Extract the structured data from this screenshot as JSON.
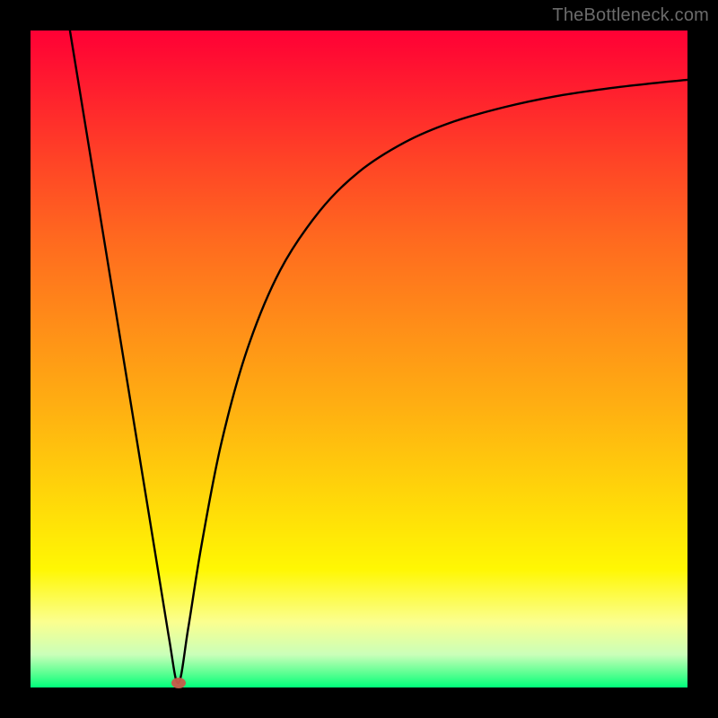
{
  "watermark": "TheBottleneck.com",
  "marker": {
    "x_pct": 22.5,
    "y_pct": 99.3
  },
  "curve_color": "#000000",
  "curve_stroke_width": 2.4,
  "chart_data": {
    "type": "line",
    "title": "",
    "xlabel": "",
    "ylabel": "",
    "xlim": [
      0,
      100
    ],
    "ylim": [
      0,
      100
    ],
    "grid": false,
    "annotations": [
      "TheBottleneck.com"
    ],
    "series": [
      {
        "name": "bottleneck-curve",
        "x": [
          6.0,
          10.0,
          14.0,
          18.0,
          21.0,
          22.5,
          24.0,
          26.0,
          29.0,
          33.0,
          38.0,
          44.0,
          50.0,
          57.0,
          64.0,
          72.0,
          80.0,
          88.0,
          95.0,
          100.0
        ],
        "y": [
          100.0,
          75.5,
          51.0,
          26.5,
          8.0,
          0.7,
          9.0,
          21.5,
          37.0,
          51.5,
          63.5,
          72.5,
          78.5,
          83.0,
          86.0,
          88.3,
          90.0,
          91.2,
          92.0,
          92.5
        ]
      }
    ],
    "marker": {
      "x": 22.5,
      "y": 0.7,
      "color": "#c85a4a"
    },
    "background_gradient": {
      "direction": "top-to-bottom",
      "stops": [
        {
          "pct": 0,
          "color": "#ff0035"
        },
        {
          "pct": 50,
          "color": "#ffa014"
        },
        {
          "pct": 82,
          "color": "#fff703"
        },
        {
          "pct": 100,
          "color": "#00ff7b"
        }
      ]
    }
  }
}
